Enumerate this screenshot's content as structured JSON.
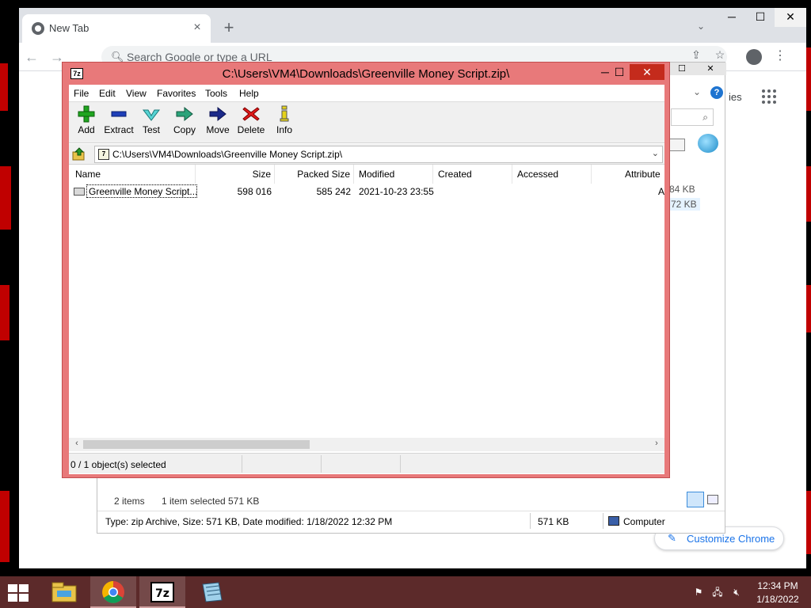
{
  "chrome": {
    "tab_title": "New Tab",
    "tab_close": "×",
    "new_tab": "+",
    "omnibox_placeholder": "Search Google or type a URL",
    "customize_label": "Customize Chrome",
    "partial_text": "ies"
  },
  "explorer": {
    "size1": "84 KB",
    "size2": "72 KB",
    "items_count": "2 items",
    "selected_count": "1 item selected",
    "selected_size": "571 KB",
    "details_type": "Type: zip Archive, Size: 571 KB, Date modified: 1/18/2022 12:32 PM",
    "details_size": "571 KB",
    "details_location": "Computer"
  },
  "sevenzip": {
    "title": "C:\\Users\\VM4\\Downloads\\Greenville Money Script.zip\\",
    "app_icon_text": "7z",
    "menu": [
      "File",
      "Edit",
      "View",
      "Favorites",
      "Tools",
      "Help"
    ],
    "toolbar": [
      "Add",
      "Extract",
      "Test",
      "Copy",
      "Move",
      "Delete",
      "Info"
    ],
    "address": "C:\\Users\\VM4\\Downloads\\Greenville Money Script.zip\\",
    "columns": [
      "Name",
      "Size",
      "Packed Size",
      "Modified",
      "Created",
      "Accessed",
      "Attribute"
    ],
    "rows": [
      {
        "name": "Greenville Money Script...",
        "size": "598 016",
        "packed_size": "585 242",
        "modified": "2021-10-23 23:55",
        "created": "",
        "accessed": "",
        "attribute": "A"
      }
    ],
    "status": "0 / 1 object(s) selected"
  },
  "taskbar": {
    "time": "12:34 PM",
    "date": "1/18/2022",
    "apps": [
      "file-explorer",
      "chrome",
      "7-zip",
      "notepad"
    ]
  },
  "colors": {
    "sevenzip_frame": "#e8797a",
    "taskbar": "#5c2a2a",
    "chrome_accent": "#1a73e8"
  }
}
